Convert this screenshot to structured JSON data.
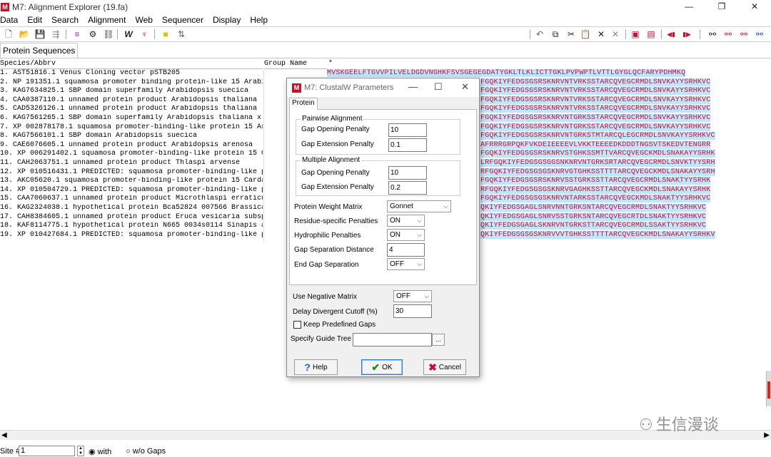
{
  "window": {
    "title": "M7: Alignment Explorer (19.fa)",
    "app_icon": "M",
    "controls": [
      "—",
      "❐",
      "✕"
    ]
  },
  "menu": [
    "Data",
    "Edit",
    "Search",
    "Alignment",
    "Web",
    "Sequencer",
    "Display",
    "Help"
  ],
  "toolbar": {
    "left_icons": [
      "new-file-icon",
      "open-folder-icon",
      "save-icon",
      "align-icon",
      "muscle-icon",
      "clustal-icon",
      "translate-icon",
      "w-icon",
      "dna-icon",
      "mark-icon",
      "arrow-icon"
    ],
    "right_icons": [
      "undo-icon",
      "copy-icon",
      "cut-icon",
      "paste-icon",
      "delete-icon",
      "delete-gap-icon",
      "insert-icon",
      "insert-block-icon",
      "prev-icon",
      "next-icon",
      "find-icon",
      "find-prev-icon",
      "find-next-icon",
      "find-motif-icon"
    ]
  },
  "tab": {
    "label": "Protein Sequences"
  },
  "grid": {
    "header_species": "Species/Abbrv",
    "header_group": "Group Name",
    "header_marker": "*",
    "names": [
      "1. AST51816.1 Venus Cloning vector pSTB205",
      "2. NP 191351.1 squamosa promoter binding protein-like 15 Arabi",
      "3. KAG7634825.1 SBP domain superfamily Arabidopsis suecica",
      "4. CAA0387110.1 unnamed protein product Arabidopsis thaliana",
      "5. CAD5326126.1 unnamed protein product Arabidopsis thaliana",
      "6. KAG7561265.1 SBP domain superfamily Arabidopsis thaliana x",
      "7. XP 002878178.1 squamosa promoter-binding-like protein 15 Ar",
      "8. KAG7566101.1 SBP domain Arabidopsis suecica",
      "9. CAE6076605.1 unnamed protein product Arabidopsis arenosa",
      "10. XP 006291402.1 squamosa promoter-binding-like protein 15 C",
      "11. CAH2063751.1 unnamed protein product Thlaspi arvense",
      "12. XP 010516431.1 PREDICTED: squamosa promoter-binding-like p",
      "13. AKC05620.1 squamosa promoter-binding-like protein 15 Carda",
      "14. XP 010504729.1 PREDICTED: squamosa promoter-binding-like p",
      "15. CAA7060637.1 unnamed protein product Microthlaspi erraticu",
      "16. KAG2324038.1 hypothetical protein Bca52824 007566 Brassica",
      "17. CAH8384605.1 unnamed protein product Eruca vesicaria subsp",
      "18. KAF8114775.1 hypothetical protein N665 0034s0114 Sinapis a",
      "19. XP 010427684.1 PREDICTED: squamosa promoter-binding-like p"
    ],
    "sequences": [
      "MVSKGEELFTGVVPILVELDGDVNGHKFSVSGEGEGDATYGKLTLKLICTTGKLPVPWPTLVTTLGYGLQCFARYPDHMKQ",
      "FGQKIYFEDGSGSRSKNRVNTVRKSSTARCQVEGCRMDLSNVKAYYSRHKVC",
      "FGQKIYFEDGSGSRSKNRVNTVRKSSTARCQVEGCRMDLSNVKAYYSRHKVC",
      "FGQKIYFEDGSGSRSKNRVNTVRKSSTARCQVEGCRMDLSNVKAYYSRHKVC",
      "FGQKIYFEDGSGSRSKNRVNTVRKSSTARCQVEGCRMDLSNVKAYYSRHKVC",
      "FGQKIYFEDGSGSRSKNRVNTGRKSSTARCQVEGCRMDLSNVKAYYSRHKVC",
      "FGQKIYFEDGSGSRSKNRVNTGRKSSTARCQVEGCRMDLSNVKAYYSRHKVC",
      "FGQKIYFEDGSGSRSKNRVNTGRKSTMTARCQLEGCRMDLSNVKAYYSRHKVC",
      "AFRRRGRPQKFVKDEIEEEEVLVKKTEEEEDKDDDTNGSVTSKEDVTENGRR",
      "FGQKIYFEDGSGSRSKNRVSTGHKSSMTTVARCQVEGCKMDLSNAKAYYSRHK",
      "LRFGQKIYFEDGSGSGGSNKNRVNTGRKSRTARCQVEGCRMDLSNVKTYYSRH",
      "RFGQKIYFEDGSGSGSKNRVGTGHKSSTTTTARCQVEGCKMDLSNAKAYYSRH",
      "FGQKIYFEDGSGSRSKNRVSSTGRKSSTTARCQVEGCRMDLSNAKTYYSRHK",
      "RFGQKIYFEDGSGSGSKNRVGAGHKSSTTARCQVEGCKMDLSNAKAYYSRHK",
      "FGQKIYFEDGSGSGSKNRVNTARKSSTARCQVEGCKMDLSNAKTYYSRHKVC",
      "QKIYFEDGSGAGLSNRVNNTGRKSNTARCQVEGCRMDLSNAKTYYSRHKVC",
      "QKIYFEDGSGAGLSNRVSSTGRKSNTARCQVEGCRTDLSNAKTYYSRHKVC",
      "QKIYFEDGSGAGLSKNRVNTGRKSTTARCQVEGCRMDLSSAKTYYSRHKVC",
      "QKIYFEDGSGSGSKNRVVVTGHKSSTTTTARCQVEGCKMDLSNAKAYYSRHKV"
    ],
    "sequence_offsets": [
      0,
      215,
      215,
      215,
      215,
      215,
      215,
      215,
      215,
      215,
      215,
      215,
      215,
      215,
      215,
      215,
      215,
      215,
      215
    ]
  },
  "status": {
    "site_label": "Site #",
    "site_value": "1",
    "with_label": "with",
    "without_label": "w/o Gaps"
  },
  "watermark": {
    "text": "生信漫谈"
  },
  "dialog": {
    "title": "M7: ClustalW Parameters",
    "tab": "Protein",
    "pairwise": {
      "legend": "Pairwise Alignment",
      "gap_open_label": "Gap Opening Penalty",
      "gap_open_value": "10",
      "gap_ext_label": "Gap Extension Penalty",
      "gap_ext_value": "0.1"
    },
    "multiple": {
      "legend": "Multiple Alignment",
      "gap_open_label": "Gap Opening Penalty",
      "gap_open_value": "10",
      "gap_ext_label": "Gap Extension Penalty",
      "gap_ext_value": "0.2"
    },
    "weight_matrix_label": "Protein Weight Matrix",
    "weight_matrix_value": "Gonnet",
    "residue_label": "Residue-specific Penalties",
    "residue_value": "ON",
    "hydrophilic_label": "Hydrophilic Penalties",
    "hydrophilic_value": "ON",
    "gap_sep_label": "Gap Separation Distance",
    "gap_sep_value": "4",
    "end_gap_label": "End Gap Separation",
    "end_gap_value": "OFF",
    "neg_matrix_label": "Use Negative Matrix",
    "neg_matrix_value": "OFF",
    "delay_label": "Delay Divergent Cutoff (%)",
    "delay_value": "30",
    "keep_gaps_label": "Keep Predefined Gaps",
    "guide_tree_label": "Specify Guide Tree",
    "guide_tree_value": "",
    "browse_label": "...",
    "help_label": "Help",
    "ok_label": "OK",
    "cancel_label": "Cancel"
  }
}
